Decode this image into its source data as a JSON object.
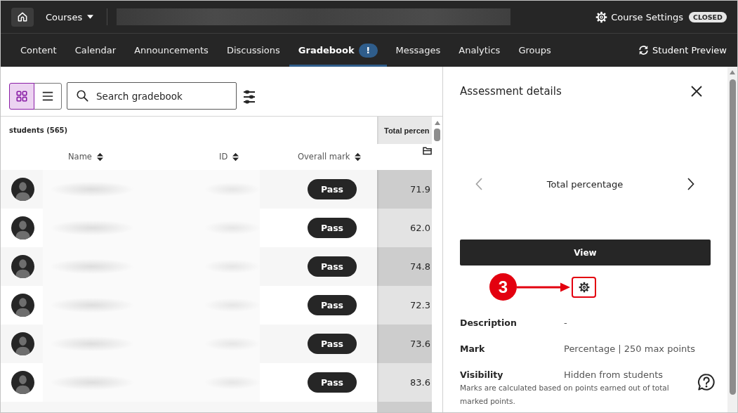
{
  "top_bar": {
    "courses_menu": "Courses",
    "course_settings": "Course Settings",
    "status_badge": "CLOSED"
  },
  "nav": {
    "tabs": [
      {
        "label": "Content",
        "selected": false
      },
      {
        "label": "Calendar",
        "selected": false
      },
      {
        "label": "Announcements",
        "selected": false
      },
      {
        "label": "Discussions",
        "selected": false
      },
      {
        "label": "Gradebook",
        "selected": true,
        "badge": "!"
      },
      {
        "label": "Messages",
        "selected": false
      },
      {
        "label": "Analytics",
        "selected": false
      },
      {
        "label": "Groups",
        "selected": false
      }
    ],
    "student_preview": "Student Preview"
  },
  "gradebook": {
    "view_toggle": [
      {
        "kind": "grid",
        "selected": true
      },
      {
        "kind": "list",
        "selected": false
      }
    ],
    "search": {
      "placeholder": "Search gradebook"
    },
    "student_count": "students (565)",
    "columns": [
      "Name",
      "ID",
      "Overall mark"
    ],
    "column_4": {
      "title": "Total percen"
    },
    "rows": [
      {
        "overall_mark": "Pass",
        "column_4": "71.9"
      },
      {
        "overall_mark": "Pass",
        "column_4": "62.0"
      },
      {
        "overall_mark": "Pass",
        "column_4": "74.8"
      },
      {
        "overall_mark": "Pass",
        "column_4": "72.3"
      },
      {
        "overall_mark": "Pass",
        "column_4": "73.6"
      },
      {
        "overall_mark": "Pass",
        "column_4": "83.6"
      }
    ]
  },
  "details_panel": {
    "title": "Assessment details",
    "carousel": {
      "title": "Total percentage",
      "prev": {
        "disabled": true
      },
      "next": {
        "disabled": false
      }
    },
    "view_button": "View",
    "callout": {
      "number": "3"
    },
    "fields": [
      {
        "label": "Description",
        "value": "-"
      },
      {
        "label": "Mark",
        "value": "Percentage | 250 max points"
      },
      {
        "label": "Visibility",
        "value": "Hidden from students",
        "note": "Marks are calculated based on points earned out of total marked points."
      }
    ]
  }
}
